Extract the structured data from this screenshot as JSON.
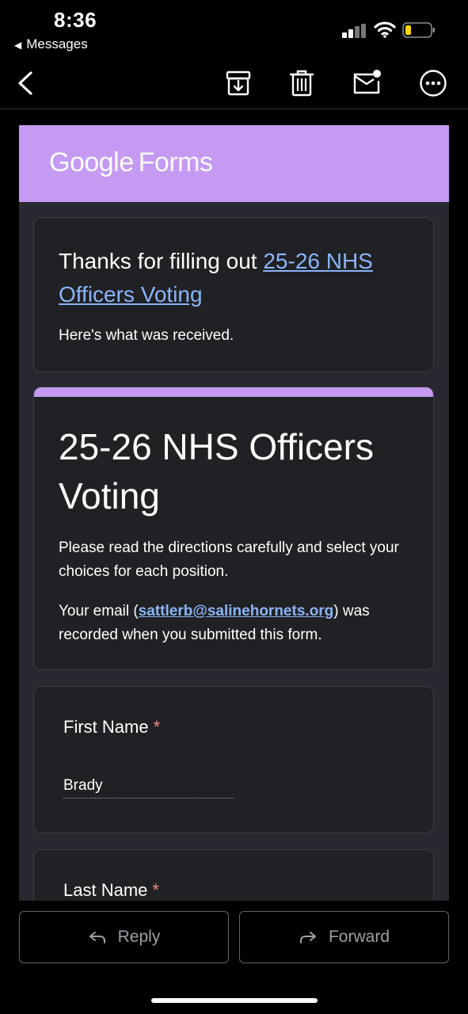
{
  "status_bar": {
    "time": "8:36",
    "back_app": "Messages",
    "back_arrow": "◀"
  },
  "toolbar": {
    "icons": [
      "back-chevron-icon",
      "archive-icon",
      "trash-icon",
      "mark-unread-icon",
      "more-icon"
    ]
  },
  "form_header": {
    "logo_google": "Google",
    "logo_forms": "Forms",
    "accent_color": "#c49af2"
  },
  "thanks_card": {
    "prefix": "Thanks for filling out ",
    "link": "25-26 NHS Officers Voting",
    "received": "Here's what was received."
  },
  "title_card": {
    "title": "25-26 NHS Officers Voting",
    "description": "Please read the directions carefully and select your choices for each position.",
    "email_prefix": "Your email (",
    "email": "sattlerb@salinehornets.org",
    "email_suffix": ") was recorded when you submitted this form."
  },
  "questions": [
    {
      "label": "First Name",
      "required_mark": "*",
      "answer": "Brady"
    },
    {
      "label": "Last Name",
      "required_mark": "*"
    }
  ],
  "actions": {
    "reply": "Reply",
    "forward": "Forward"
  }
}
